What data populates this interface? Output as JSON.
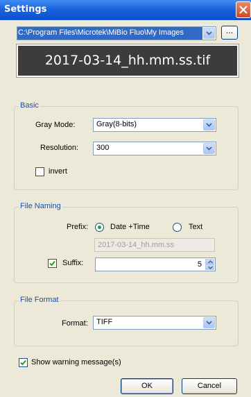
{
  "window": {
    "title": "Settings"
  },
  "path": {
    "value": "C:\\Program Files\\Microtek\\MiBio Fluo\\My Images",
    "browse_label": "..."
  },
  "preview": {
    "filename": "2017-03-14_hh.mm.ss.tif"
  },
  "basic": {
    "group_label": "Basic",
    "gray_mode_label": "Gray Mode:",
    "gray_mode_value": "Gray(8-bits)",
    "resolution_label": "Resolution:",
    "resolution_value": "300",
    "invert_label": "invert",
    "invert_checked": false
  },
  "file_naming": {
    "group_label": "File Naming",
    "prefix_label": "Prefix:",
    "prefix_options": [
      {
        "label": "Date +Time",
        "selected": true
      },
      {
        "label": "Text",
        "selected": false
      }
    ],
    "prefix_text": "2017-03-14_hh.mm.ss",
    "suffix_label": "Suffix:",
    "suffix_checked": true,
    "suffix_value": "5"
  },
  "file_format": {
    "group_label": "File Format",
    "format_label": "Format:",
    "format_value": "TIFF"
  },
  "show_warning": {
    "label": "Show warning message(s)",
    "checked": true
  },
  "buttons": {
    "ok": "OK",
    "cancel": "Cancel"
  },
  "colors": {
    "title_bar": "#1d63dc",
    "selection": "#316ac5",
    "preview_bg": "#3c3c3c",
    "group_label": "#1e4ea0",
    "check_mark": "#21a121"
  }
}
